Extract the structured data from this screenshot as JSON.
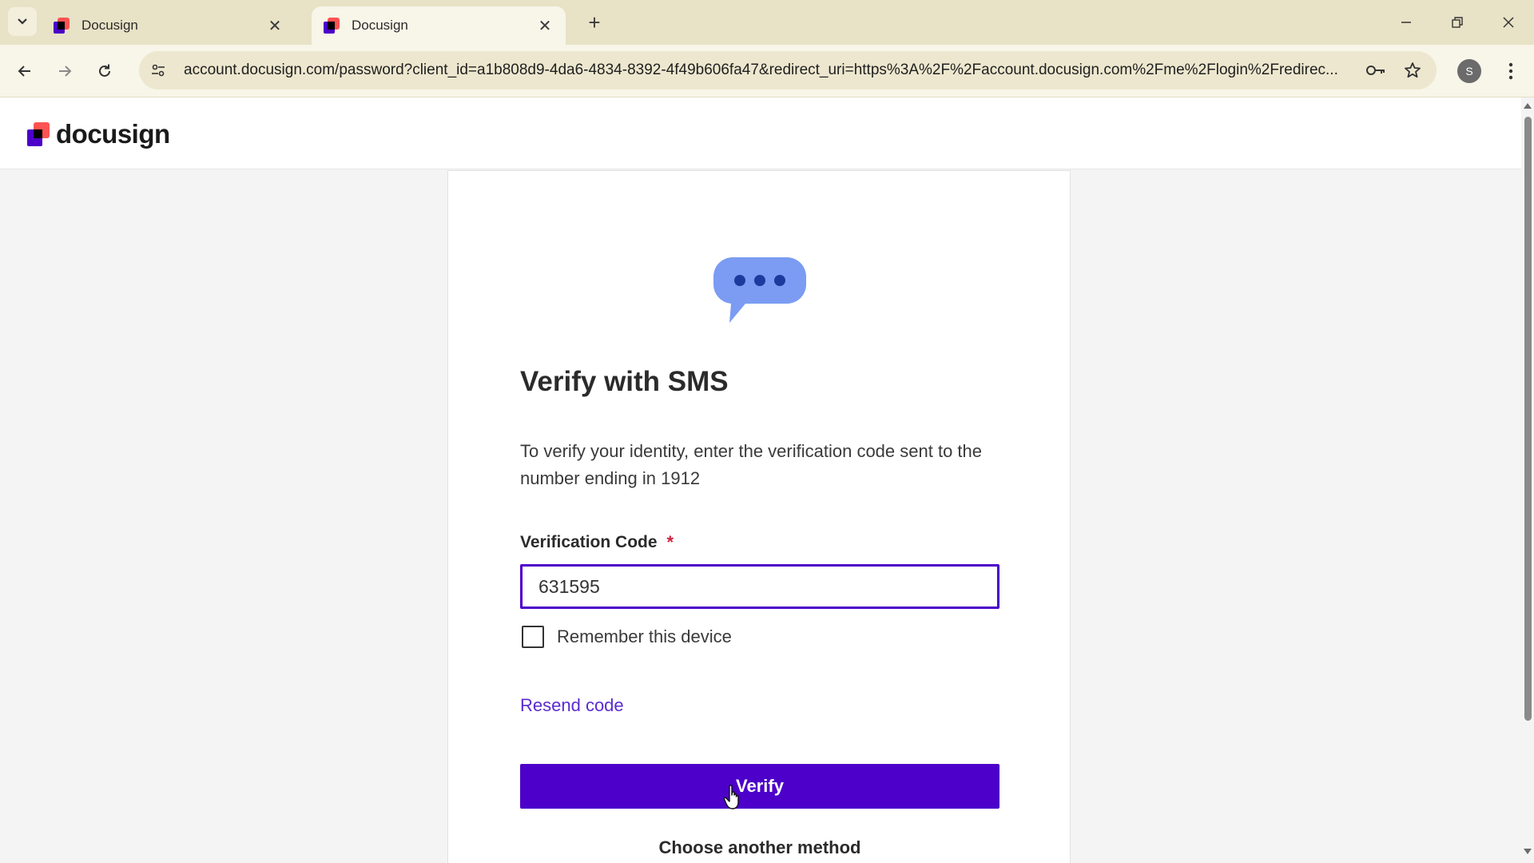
{
  "browser": {
    "tabs": [
      {
        "title": "Docusign",
        "active": false
      },
      {
        "title": "Docusign",
        "active": true
      }
    ],
    "new_tab_label": "+",
    "url": "account.docusign.com/password?client_id=a1b808d9-4da6-4834-8392-4f49b606fa47&redirect_uri=https%3A%2F%2Faccount.docusign.com%2Fme%2Flogin%2Fredirec...",
    "profile_initial": "S",
    "icons": {
      "tab_search": "chevron-down-icon",
      "back": "arrow-left-icon",
      "forward": "arrow-right-icon",
      "reload": "reload-icon",
      "site_info": "tune-icon",
      "password": "key-icon",
      "bookmark": "star-icon",
      "menu": "kebab-icon",
      "minimize": "minimize-icon",
      "restore": "restore-icon",
      "close": "close-icon"
    }
  },
  "header": {
    "logo_text": "docusign"
  },
  "form": {
    "title": "Verify with SMS",
    "description": "To verify your identity, enter the verification code sent to the number ending in 1912",
    "code_label": "Verification Code",
    "required_marker": "*",
    "code_value": "631595",
    "remember_label": "Remember this device",
    "remember_checked": false,
    "resend_label": "Resend code",
    "verify_label": "Verify",
    "other_method_label": "Choose another method"
  },
  "colors": {
    "accent": "#4c00c9",
    "link": "#5b2bd0",
    "required": "#d2203a",
    "sms_icon": "#7b9cf2",
    "sms_dots": "#1c3b9e"
  }
}
